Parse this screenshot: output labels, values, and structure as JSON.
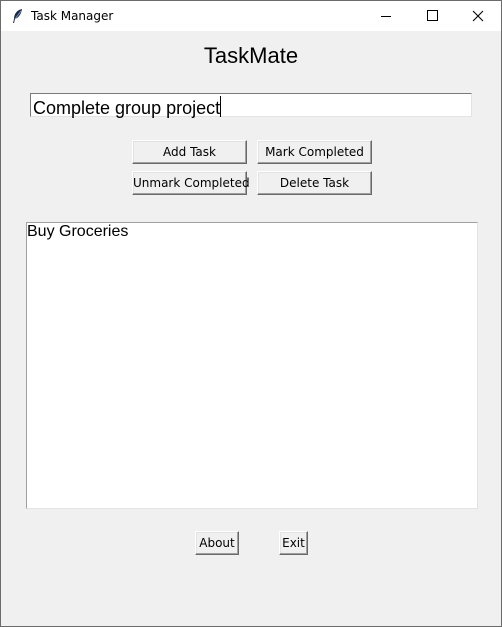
{
  "window": {
    "title": "Task Manager",
    "app_icon": "feather-icon"
  },
  "header": {
    "title": "TaskMate"
  },
  "task_input": {
    "value": "Complete group project"
  },
  "buttons": {
    "add": "Add Task",
    "mark": "Mark Completed",
    "unmark": "Unmark Completed",
    "delete": "Delete Task",
    "about": "About",
    "exit": "Exit"
  },
  "tasks": [
    "Buy Groceries"
  ]
}
